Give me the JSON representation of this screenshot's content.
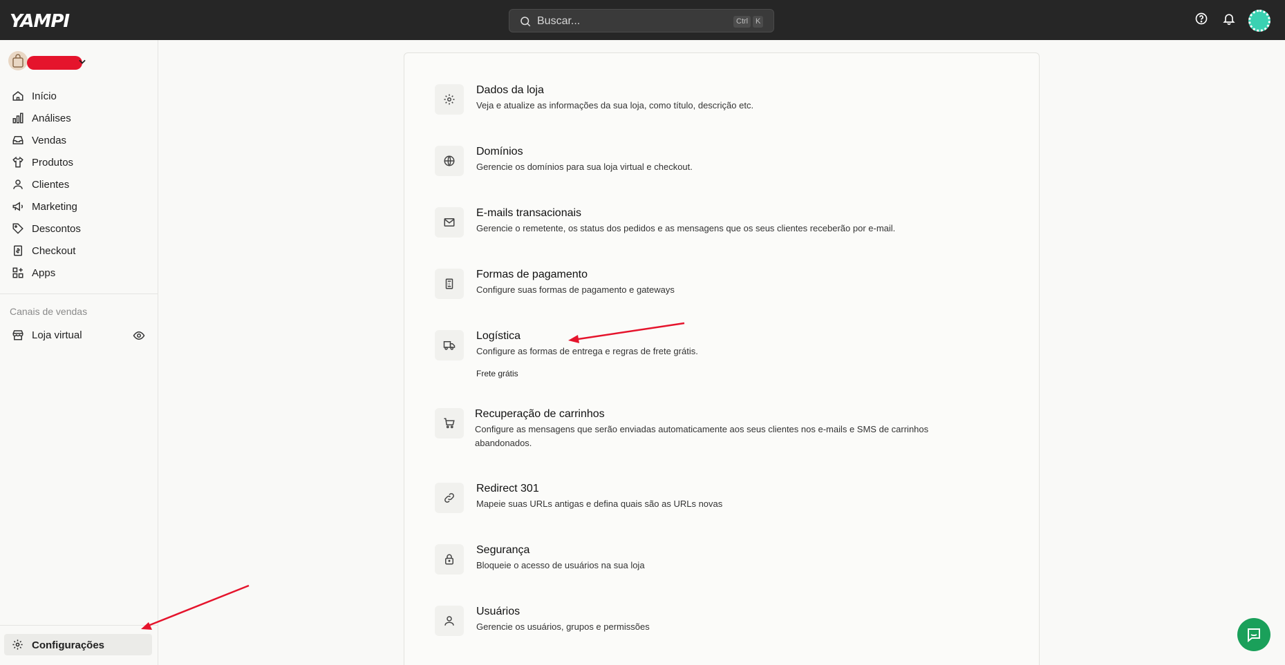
{
  "header": {
    "logo": "YAMPI",
    "search_placeholder": "Buscar...",
    "shortcut_ctrl": "Ctrl",
    "shortcut_key": "K"
  },
  "sidebar": {
    "items": [
      {
        "label": "Início",
        "icon": "home-icon"
      },
      {
        "label": "Análises",
        "icon": "bar-chart-icon"
      },
      {
        "label": "Vendas",
        "icon": "inbox-icon"
      },
      {
        "label": "Produtos",
        "icon": "shirt-icon"
      },
      {
        "label": "Clientes",
        "icon": "user-icon"
      },
      {
        "label": "Marketing",
        "icon": "megaphone-icon"
      },
      {
        "label": "Descontos",
        "icon": "tag-icon"
      },
      {
        "label": "Checkout",
        "icon": "receipt-icon"
      },
      {
        "label": "Apps",
        "icon": "apps-grid-icon"
      }
    ],
    "sales_channels_title": "Canais de vendas",
    "store_channel": "Loja virtual",
    "settings": "Configurações"
  },
  "settings": [
    {
      "title": "Dados da loja",
      "desc": "Veja e atualize as informações da sua loja, como título, descrição etc.",
      "icon": "gear-icon"
    },
    {
      "title": "Domínios",
      "desc": "Gerencie os domínios para sua loja virtual e checkout.",
      "icon": "globe-icon"
    },
    {
      "title": "E-mails transacionais",
      "desc": "Gerencie o remetente, os status dos pedidos e as mensagens que os seus clientes receberão por e-mail.",
      "icon": "mail-icon"
    },
    {
      "title": "Formas de pagamento",
      "desc": "Configure suas formas de pagamento e gateways",
      "icon": "payment-terminal-icon"
    },
    {
      "title": "Logística",
      "desc": "Configure as formas de entrega e regras de frete grátis.",
      "sub": "Frete grátis",
      "icon": "truck-icon"
    },
    {
      "title": "Recuperação de carrinhos",
      "desc": "Configure as mensagens que serão enviadas automaticamente aos seus clientes nos e-mails e SMS de carrinhos abandonados.",
      "icon": "cart-icon"
    },
    {
      "title": "Redirect 301",
      "desc": "Mapeie suas URLs antigas e defina quais são as URLs novas",
      "icon": "link-icon"
    },
    {
      "title": "Segurança",
      "desc": "Bloqueie o acesso de usuários na sua loja",
      "icon": "lock-icon"
    },
    {
      "title": "Usuários",
      "desc": "Gerencie os usuários, grupos e permissões",
      "icon": "user-icon"
    }
  ],
  "colors": {
    "topbar": "#262626",
    "annotation_arrow": "#e5142c",
    "chat_button": "#1aa05a"
  }
}
